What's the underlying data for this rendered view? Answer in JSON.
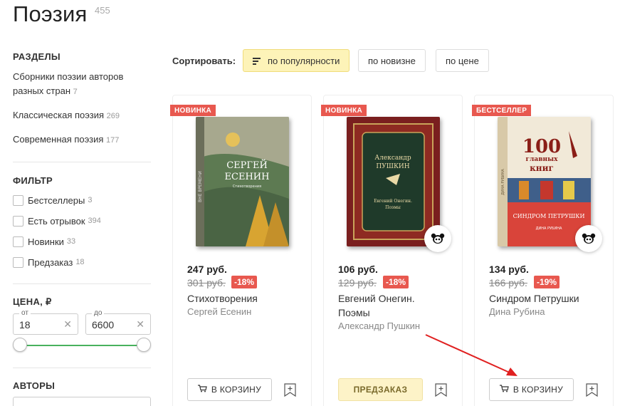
{
  "page": {
    "title": "Поэзия",
    "count": "455"
  },
  "sidebar": {
    "sections_heading": "РАЗДЕЛЫ",
    "sections": [
      {
        "label_line1": "Сборники поэзии авторов",
        "label_line2": "разных стран",
        "count": "7"
      },
      {
        "label": "Классическая поэзия",
        "count": "269"
      },
      {
        "label": "Современная поэзия",
        "count": "177"
      }
    ],
    "filter_heading": "ФИЛЬТР",
    "filters": [
      {
        "label": "Бестселлеры",
        "count": "3",
        "checked": false
      },
      {
        "label": "Есть отрывок",
        "count": "394",
        "checked": false
      },
      {
        "label": "Новинки",
        "count": "33",
        "checked": false
      },
      {
        "label": "Предзаказ",
        "count": "18",
        "checked": false
      }
    ],
    "price_heading": "ЦЕНА, ₽",
    "price_from_label": "от",
    "price_from_value": "18",
    "price_to_label": "до",
    "price_to_value": "6600",
    "authors_heading": "АВТОРЫ"
  },
  "sort": {
    "label": "Сортировать:",
    "options": [
      "по популярности",
      "по новизне",
      "по цене"
    ],
    "active": "по популярности"
  },
  "products": [
    {
      "badge": "НОВИНКА",
      "price": "247 руб.",
      "old_price": "301 руб.",
      "discount": "-18%",
      "title_line1": "Стихотворения",
      "title_line2": "",
      "author": "Сергей Есенин",
      "button": "В КОРЗИНУ",
      "cover_text_top": "СЕРГЕЙ",
      "cover_text_bottom": "ЕСЕНИН",
      "cover_subtitle": "Стихотворения",
      "cover_spine": "ВНЕ ВРЕМЕНИ"
    },
    {
      "badge": "НОВИНКА",
      "price": "106 руб.",
      "old_price": "129 руб.",
      "discount": "-18%",
      "title_line1": "Евгений Онегин.",
      "title_line2": "Поэмы",
      "author": "Александр Пушкин",
      "button": "ПРЕДЗАКАЗ",
      "cover_text_top": "Александр",
      "cover_text_bottom": "ПУШКИН",
      "cover_subtitle1": "Евгений Онегин.",
      "cover_subtitle2": "Поэмы"
    },
    {
      "badge": "БЕСТСЕЛЛЕР",
      "price": "134 руб.",
      "old_price": "166 руб.",
      "discount": "-19%",
      "title_line1": "Синдром Петрушки",
      "title_line2": "",
      "author": "Дина Рубина",
      "button": "В КОРЗИНУ",
      "cover_num": "100",
      "cover_line2": "главных",
      "cover_line3": "книг",
      "cover_title": "СИНДРОМ ПЕТРУШКИ",
      "cover_author": "ДИНА РУБИНА",
      "cover_spine": "ДИНА РУБИНА"
    }
  ],
  "colors": {
    "accent_red": "#e8584f",
    "active_sort": "#fdf3b8",
    "slider_green": "#48b15d"
  }
}
